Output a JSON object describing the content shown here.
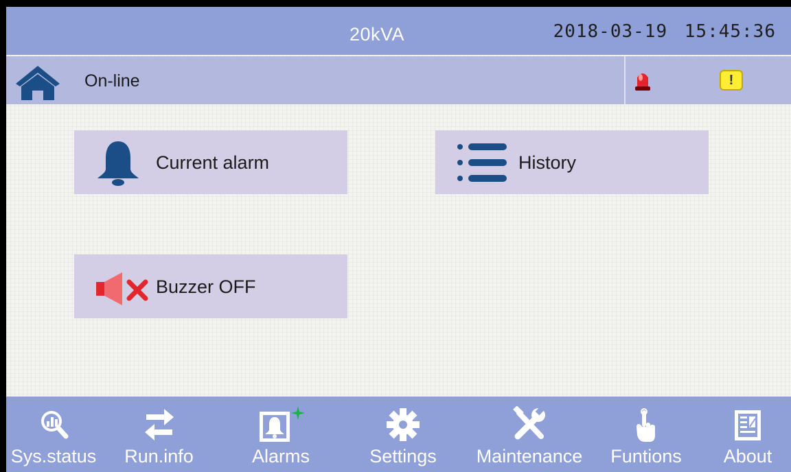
{
  "header": {
    "model": "20kVA",
    "date": "2018-03-19",
    "time": "15:45:36"
  },
  "status_bar": {
    "state": "On-line",
    "home_icon": "home-icon",
    "alarm_icon": "red-beacon-icon",
    "warning_icon": "warning-badge-icon",
    "warning_symbol": "!"
  },
  "tiles": {
    "current_alarm": {
      "label": "Current alarm",
      "icon": "bell-icon"
    },
    "history": {
      "label": "History",
      "icon": "list-icon"
    },
    "buzzer": {
      "label": "Buzzer OFF",
      "icon": "speaker-muted-icon"
    }
  },
  "nav": {
    "items": [
      {
        "label": "Sys.status",
        "icon": "magnifier-chart-icon"
      },
      {
        "label": "Run.info",
        "icon": "swap-arrows-icon"
      },
      {
        "label": "Alarms",
        "icon": "alarm-bell-icon"
      },
      {
        "label": "Settings",
        "icon": "gear-icon"
      },
      {
        "label": "Maintenance",
        "icon": "wrench-screwdriver-icon"
      },
      {
        "label": "Funtions",
        "icon": "hand-pointer-icon"
      },
      {
        "label": "About",
        "icon": "document-icon"
      }
    ]
  },
  "colors": {
    "bar_blue": "#8f9fd8",
    "status_bar": "#b3b9de",
    "tile_bg": "#d3cde6",
    "icon_navy": "#1b4d86",
    "alert_red": "#e2262d",
    "new_alarm_green": "#19b34a"
  }
}
